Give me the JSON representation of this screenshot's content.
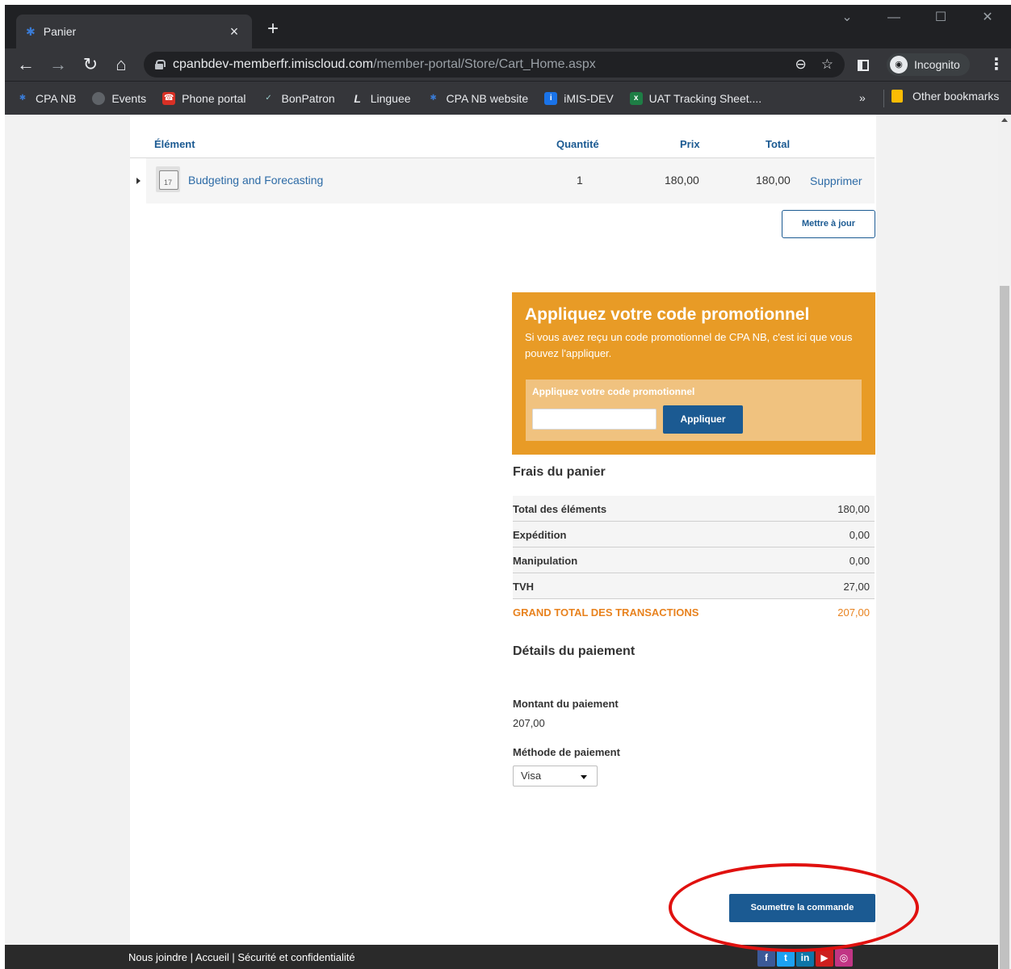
{
  "browser": {
    "tab_title": "Panier",
    "url_host": "cpanbdev-memberfr.imiscloud.com",
    "url_path": "/member-portal/Store/Cart_Home.aspx",
    "incognito_label": "Incognito",
    "bookmarks": [
      {
        "label": "CPA NB",
        "icon": "maple-leaf-icon"
      },
      {
        "label": "Events",
        "icon": "globe-icon"
      },
      {
        "label": "Phone portal",
        "icon": "phone-icon"
      },
      {
        "label": "BonPatron",
        "icon": "check-icon"
      },
      {
        "label": "Linguee",
        "icon": "linguee-icon"
      },
      {
        "label": "CPA NB website",
        "icon": "maple-leaf-icon"
      },
      {
        "label": "iMIS-DEV",
        "icon": "imis-icon"
      },
      {
        "label": "UAT Tracking Sheet....",
        "icon": "excel-icon"
      }
    ],
    "bookmarks_more": "»",
    "other_bookmarks": "Other bookmarks"
  },
  "cart": {
    "headers": {
      "item": "Élément",
      "quantity": "Quantité",
      "price": "Prix",
      "total": "Total"
    },
    "rows": [
      {
        "calendar_day": "17",
        "name": "Budgeting and Forecasting",
        "quantity": "1",
        "price": "180,00",
        "total": "180,00",
        "delete_label": "Supprimer"
      }
    ],
    "update_button": "Mettre à jour"
  },
  "promo": {
    "title": "Appliquez votre code promotionnel",
    "description": "Si vous avez reçu un code promotionnel de CPA NB, c'est ici que vous pouvez l'appliquer.",
    "box_label": "Appliquez votre code promotionnel",
    "input_value": "",
    "apply_button": "Appliquer"
  },
  "fees": {
    "title": "Frais du panier",
    "rows": [
      {
        "label": "Total des éléments",
        "value": "180,00"
      },
      {
        "label": "Expédition",
        "value": "0,00"
      },
      {
        "label": "Manipulation",
        "value": "0,00"
      },
      {
        "label": "TVH",
        "value": "27,00"
      }
    ],
    "grand_total_label": "GRAND TOTAL DES TRANSACTIONS",
    "grand_total_value": "207,00"
  },
  "payment": {
    "title": "Détails du paiement",
    "amount_label": "Montant du paiement",
    "amount_value": "207,00",
    "method_label": "Méthode de paiement",
    "method_value": "Visa",
    "submit_button": "Soumettre la commande"
  },
  "footer": {
    "links": "Nous joindre | Accueil | Sécurité et confidentialité",
    "socials": [
      {
        "glyph": "f",
        "color": "#3b5998",
        "icon": "facebook-icon"
      },
      {
        "glyph": "t",
        "color": "#1da1f2",
        "icon": "twitter-icon"
      },
      {
        "glyph": "in",
        "color": "#0e76a8",
        "icon": "linkedin-icon"
      },
      {
        "glyph": "▶",
        "color": "#cd201f",
        "icon": "youtube-icon"
      },
      {
        "glyph": "◎",
        "color": "#c13584",
        "icon": "instagram-icon"
      }
    ]
  },
  "colors": {
    "primary": "#1b5a92",
    "promo": "#e89b26",
    "grand_total": "#e8821e",
    "annotation": "#e0110f"
  }
}
